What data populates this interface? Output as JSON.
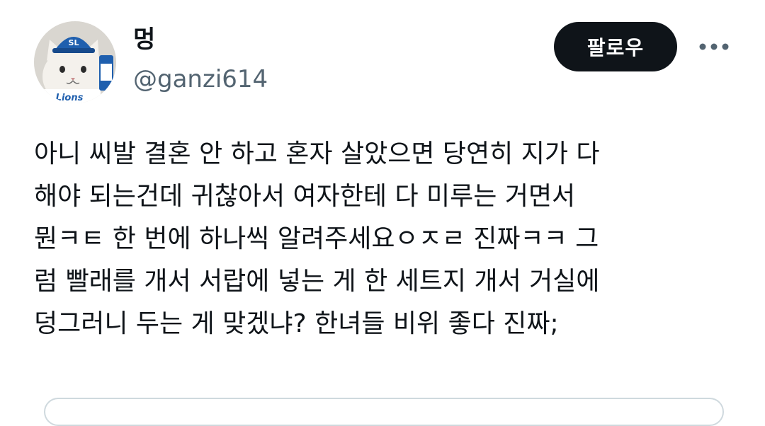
{
  "author": {
    "display_name": "멍",
    "handle": "@ganzi614",
    "avatar_icon": "cat-with-baseball-cap-avatar",
    "avatar_cap_text": "SL",
    "avatar_towel_text": "Lions"
  },
  "actions": {
    "follow_label": "팔로우",
    "more_icon": "more-horizontal-icon"
  },
  "tweet": {
    "lines": [
      "아니 씨발 결혼 안 하고 혼자 살았으면 당연히 지가 다",
      "해야 되는건데 귀찮아서 여자한테 다 미루는 거면서",
      "뭔ㅋㅌ 한 번에 하나씩 알려주세요ㅇㅈㄹ 진짜ㅋㅋ 그",
      "럼 빨래를 개서 서랍에 넣는 게 한 세트지 개서 거실에",
      "덩그러니 두는 게 맞겠냐? 한녀들 비위 좋다 진짜;"
    ]
  },
  "colors": {
    "text": "#0f1419",
    "secondary_text": "#536471",
    "follow_bg": "#0f1419",
    "follow_text": "#ffffff",
    "card_border": "#cfd9de"
  }
}
